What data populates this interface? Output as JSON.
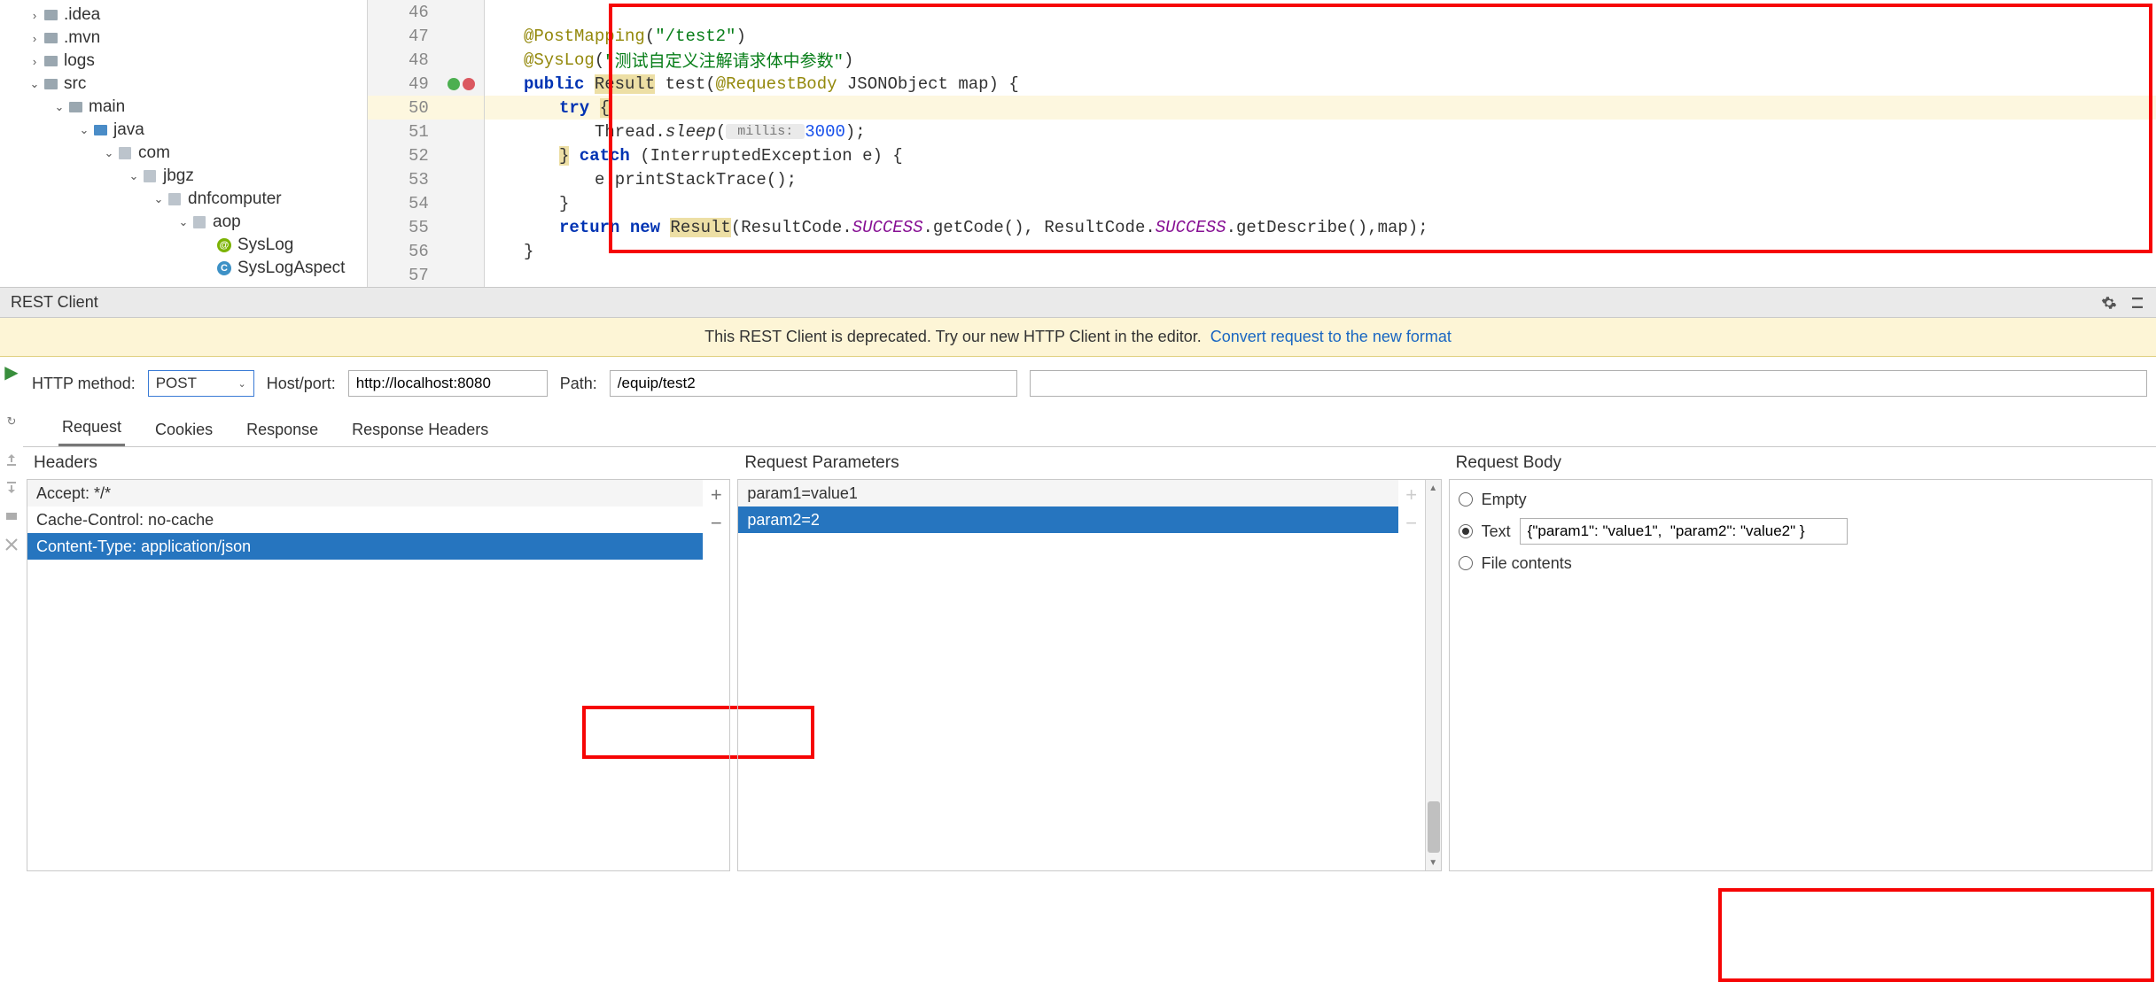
{
  "tree": {
    "items": [
      {
        "label": ".idea",
        "indent": 30,
        "arrow": "›",
        "icon": "folder"
      },
      {
        "label": ".mvn",
        "indent": 30,
        "arrow": "›",
        "icon": "folder"
      },
      {
        "label": "logs",
        "indent": 30,
        "arrow": "›",
        "icon": "folder"
      },
      {
        "label": "src",
        "indent": 30,
        "arrow": "⌄",
        "icon": "folder"
      },
      {
        "label": "main",
        "indent": 58,
        "arrow": "⌄",
        "icon": "folder"
      },
      {
        "label": "java",
        "indent": 86,
        "arrow": "⌄",
        "icon": "folder-blue"
      },
      {
        "label": "com",
        "indent": 114,
        "arrow": "⌄",
        "icon": "pkg"
      },
      {
        "label": "jbgz",
        "indent": 142,
        "arrow": "⌄",
        "icon": "pkg"
      },
      {
        "label": "dnfcomputer",
        "indent": 170,
        "arrow": "⌄",
        "icon": "pkg"
      },
      {
        "label": "aop",
        "indent": 198,
        "arrow": "⌄",
        "icon": "pkg"
      },
      {
        "label": "SysLog",
        "indent": 226,
        "arrow": "",
        "icon": "ann"
      },
      {
        "label": "SysLogAspect",
        "indent": 226,
        "arrow": "",
        "icon": "class"
      }
    ]
  },
  "editor": {
    "lines": [
      {
        "n": "46",
        "hl": false
      },
      {
        "n": "47",
        "hl": false
      },
      {
        "n": "48",
        "hl": false
      },
      {
        "n": "49",
        "hl": false,
        "icons": true
      },
      {
        "n": "50",
        "hl": true
      },
      {
        "n": "51",
        "hl": false
      },
      {
        "n": "52",
        "hl": false
      },
      {
        "n": "53",
        "hl": false
      },
      {
        "n": "54",
        "hl": false
      },
      {
        "n": "55",
        "hl": false
      },
      {
        "n": "56",
        "hl": false
      },
      {
        "n": "57",
        "hl": false
      }
    ],
    "code": {
      "l47a": "@PostMapping",
      "l47b": "(",
      "l47c": "\"/test2\"",
      "l47d": ")",
      "l48a": "@SysLog",
      "l48b": "(",
      "l48c": "\"测试自定义注解请求体中参数\"",
      "l48d": ")",
      "l49a": "public ",
      "l49b": "Result",
      "l49c": " test(",
      "l49d": "@RequestBody",
      "l49e": " JSONObject map) {",
      "l50a": "try ",
      "l50b": "{",
      "l51a": "Thread.",
      "l51b": "sleep",
      "l51c": "(",
      "l51hint": " millis: ",
      "l51d": "3000",
      "l51e": ");",
      "l52a": "}",
      "l52b": " catch ",
      "l52c": "(InterruptedException e) {",
      "l53a": "e.printStackTrace();",
      "l54a": "}",
      "l55a": "return new ",
      "l55b": "Result",
      "l55c": "(ResultCode.",
      "l55d": "SUCCESS",
      "l55e": ".getCode(), ResultCode.",
      "l55f": "SUCCESS",
      "l55g": ".getDescribe(),map);",
      "l56a": "}"
    }
  },
  "rest": {
    "title": "REST Client",
    "banner_text": "This REST Client is deprecated. Try our new HTTP Client in the editor.",
    "banner_link": "Convert request to the new format",
    "method_label": "HTTP method:",
    "method_value": "POST",
    "host_label": "Host/port:",
    "host_value": "http://localhost:8080",
    "path_label": "Path:",
    "path_value": "/equip/test2",
    "tabs": [
      "Request",
      "Cookies",
      "Response",
      "Response Headers"
    ],
    "headers_title": "Headers",
    "headers": [
      "Accept: */*",
      "Cache-Control: no-cache",
      "Content-Type: application/json"
    ],
    "params_title": "Request Parameters",
    "params": [
      "param1=value1",
      "param2=2"
    ],
    "body_title": "Request Body",
    "body_options": {
      "empty": "Empty",
      "text": "Text",
      "file": "File contents"
    },
    "body_text_value": "{\"param1\": \"value1\",  \"param2\": \"value2\" }"
  }
}
